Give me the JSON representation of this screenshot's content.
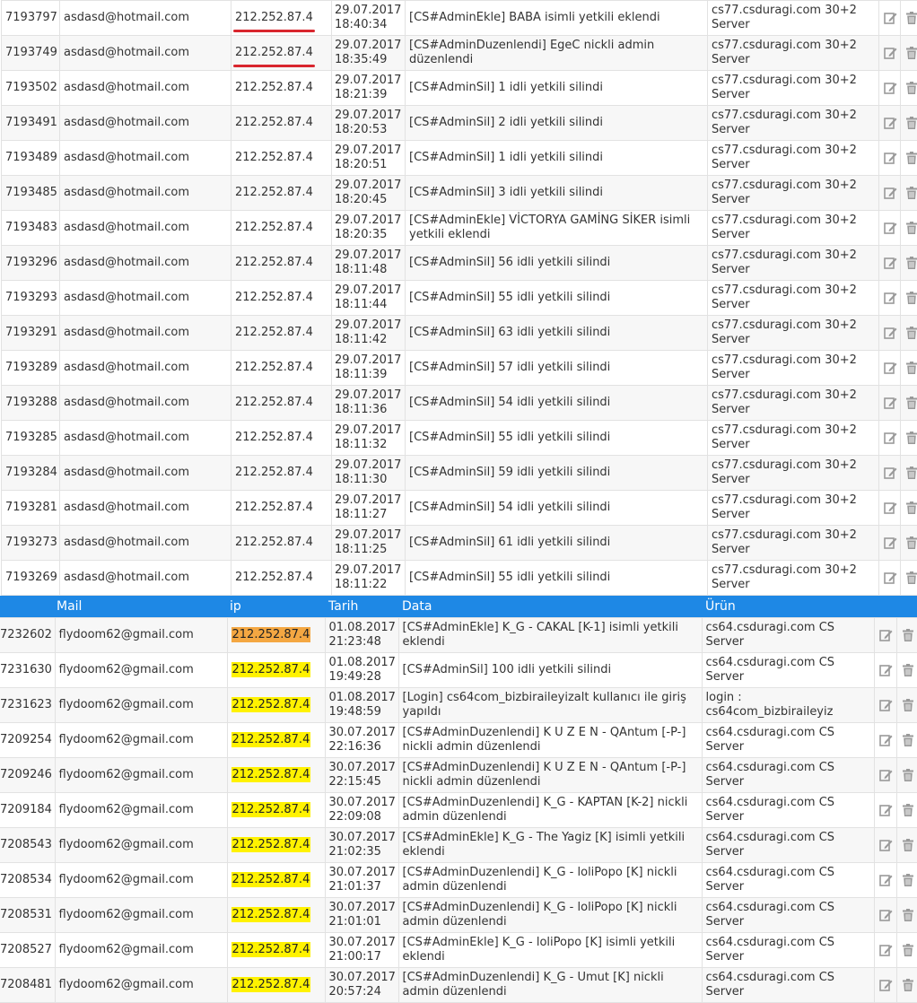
{
  "colors": {
    "header_bg": "#1e88e5",
    "ip_highlight_yellow": "#fff200",
    "ip_highlight_orange": "#f4a742",
    "underline_red": "#d9262e"
  },
  "icons": {
    "edit": "edit-icon",
    "delete": "trash-icon"
  },
  "table1": {
    "rows": [
      {
        "id": "7193797",
        "mail": "asdasd@hotmail.com",
        "ip": "212.252.87.4",
        "date": "29.07.2017",
        "time": "18:40:34",
        "data": "[CS#AdminEkle] BABA isimli yetkili eklendi",
        "product": "cs77.csduragi.com 30+2 Server",
        "underlined": true
      },
      {
        "id": "7193749",
        "mail": "asdasd@hotmail.com",
        "ip": "212.252.87.4",
        "date": "29.07.2017",
        "time": "18:35:49",
        "data": "[CS#AdminDuzenlendi] EgeC nickli admin düzenlendi",
        "product": "cs77.csduragi.com 30+2 Server",
        "underlined": true
      },
      {
        "id": "7193502",
        "mail": "asdasd@hotmail.com",
        "ip": "212.252.87.4",
        "date": "29.07.2017",
        "time": "18:21:39",
        "data": "[CS#AdminSil] 1 idli yetkili silindi",
        "product": "cs77.csduragi.com 30+2 Server"
      },
      {
        "id": "7193491",
        "mail": "asdasd@hotmail.com",
        "ip": "212.252.87.4",
        "date": "29.07.2017",
        "time": "18:20:53",
        "data": "[CS#AdminSil] 2 idli yetkili silindi",
        "product": "cs77.csduragi.com 30+2 Server"
      },
      {
        "id": "7193489",
        "mail": "asdasd@hotmail.com",
        "ip": "212.252.87.4",
        "date": "29.07.2017",
        "time": "18:20:51",
        "data": "[CS#AdminSil] 1 idli yetkili silindi",
        "product": "cs77.csduragi.com 30+2 Server"
      },
      {
        "id": "7193485",
        "mail": "asdasd@hotmail.com",
        "ip": "212.252.87.4",
        "date": "29.07.2017",
        "time": "18:20:45",
        "data": "[CS#AdminSil] 3 idli yetkili silindi",
        "product": "cs77.csduragi.com 30+2 Server"
      },
      {
        "id": "7193483",
        "mail": "asdasd@hotmail.com",
        "ip": "212.252.87.4",
        "date": "29.07.2017",
        "time": "18:20:35",
        "data": "[CS#AdminEkle] VİCTORYA GAMİNG SİKER isimli yetkili eklendi",
        "product": "cs77.csduragi.com 30+2 Server"
      },
      {
        "id": "7193296",
        "mail": "asdasd@hotmail.com",
        "ip": "212.252.87.4",
        "date": "29.07.2017",
        "time": "18:11:48",
        "data": "[CS#AdminSil] 56 idli yetkili silindi",
        "product": "cs77.csduragi.com 30+2 Server"
      },
      {
        "id": "7193293",
        "mail": "asdasd@hotmail.com",
        "ip": "212.252.87.4",
        "date": "29.07.2017",
        "time": "18:11:44",
        "data": "[CS#AdminSil] 55 idli yetkili silindi",
        "product": "cs77.csduragi.com 30+2 Server"
      },
      {
        "id": "7193291",
        "mail": "asdasd@hotmail.com",
        "ip": "212.252.87.4",
        "date": "29.07.2017",
        "time": "18:11:42",
        "data": "[CS#AdminSil] 63 idli yetkili silindi",
        "product": "cs77.csduragi.com 30+2 Server"
      },
      {
        "id": "7193289",
        "mail": "asdasd@hotmail.com",
        "ip": "212.252.87.4",
        "date": "29.07.2017",
        "time": "18:11:39",
        "data": "[CS#AdminSil] 57 idli yetkili silindi",
        "product": "cs77.csduragi.com 30+2 Server"
      },
      {
        "id": "7193288",
        "mail": "asdasd@hotmail.com",
        "ip": "212.252.87.4",
        "date": "29.07.2017",
        "time": "18:11:36",
        "data": "[CS#AdminSil] 54 idli yetkili silindi",
        "product": "cs77.csduragi.com 30+2 Server"
      },
      {
        "id": "7193285",
        "mail": "asdasd@hotmail.com",
        "ip": "212.252.87.4",
        "date": "29.07.2017",
        "time": "18:11:32",
        "data": "[CS#AdminSil] 55 idli yetkili silindi",
        "product": "cs77.csduragi.com 30+2 Server"
      },
      {
        "id": "7193284",
        "mail": "asdasd@hotmail.com",
        "ip": "212.252.87.4",
        "date": "29.07.2017",
        "time": "18:11:30",
        "data": "[CS#AdminSil] 59 idli yetkili silindi",
        "product": "cs77.csduragi.com 30+2 Server"
      },
      {
        "id": "7193281",
        "mail": "asdasd@hotmail.com",
        "ip": "212.252.87.4",
        "date": "29.07.2017",
        "time": "18:11:27",
        "data": "[CS#AdminSil] 54 idli yetkili silindi",
        "product": "cs77.csduragi.com 30+2 Server"
      },
      {
        "id": "7193273",
        "mail": "asdasd@hotmail.com",
        "ip": "212.252.87.4",
        "date": "29.07.2017",
        "time": "18:11:25",
        "data": "[CS#AdminSil] 61 idli yetkili silindi",
        "product": "cs77.csduragi.com 30+2 Server"
      },
      {
        "id": "7193269",
        "mail": "asdasd@hotmail.com",
        "ip": "212.252.87.4",
        "date": "29.07.2017",
        "time": "18:11:22",
        "data": "[CS#AdminSil] 55 idli yetkili silindi",
        "product": "cs77.csduragi.com 30+2 Server"
      }
    ]
  },
  "table2": {
    "headers": {
      "mail": "Mail",
      "ip": "ip",
      "date": "Tarih",
      "data": "Data",
      "product": "Ürün"
    },
    "rows": [
      {
        "id": "7232602",
        "mail": "flydoom62@gmail.com",
        "ip": "212.252.87.4",
        "highlight": "orange",
        "date": "01.08.2017",
        "time": "21:23:48",
        "data": "[CS#AdminEkle] K_G - CAKAL [K-1] isimli yetkili eklendi",
        "product": "cs64.csduragi.com CS Server"
      },
      {
        "id": "7231630",
        "mail": "flydoom62@gmail.com",
        "ip": "212.252.87.4",
        "highlight": "yellow",
        "date": "01.08.2017",
        "time": "19:49:28",
        "data": "[CS#AdminSil] 100 idli yetkili silindi",
        "product": "cs64.csduragi.com CS Server"
      },
      {
        "id": "7231623",
        "mail": "flydoom62@gmail.com",
        "ip": "212.252.87.4",
        "highlight": "yellow",
        "date": "01.08.2017",
        "time": "19:48:59",
        "data": "[Login] cs64com_bizbiraileyizalt kullanıcı ile giriş yapıldı",
        "product": "login : cs64com_bizbiraileyiz"
      },
      {
        "id": "7209254",
        "mail": "flydoom62@gmail.com",
        "ip": "212.252.87.4",
        "highlight": "yellow",
        "date": "30.07.2017",
        "time": "22:16:36",
        "data": "[CS#AdminDuzenlendi] K U Z E N - QAntum [-P-] nickli admin düzenlendi",
        "product": "cs64.csduragi.com CS Server"
      },
      {
        "id": "7209246",
        "mail": "flydoom62@gmail.com",
        "ip": "212.252.87.4",
        "highlight": "yellow",
        "date": "30.07.2017",
        "time": "22:15:45",
        "data": "[CS#AdminDuzenlendi] K U Z E N - QAntum [-P-] nickli admin düzenlendi",
        "product": "cs64.csduragi.com CS Server"
      },
      {
        "id": "7209184",
        "mail": "flydoom62@gmail.com",
        "ip": "212.252.87.4",
        "highlight": "yellow",
        "date": "30.07.2017",
        "time": "22:09:08",
        "data": "[CS#AdminDuzenlendi] K_G - KAPTAN [K-2] nickli admin düzenlendi",
        "product": "cs64.csduragi.com CS Server"
      },
      {
        "id": "7208543",
        "mail": "flydoom62@gmail.com",
        "ip": "212.252.87.4",
        "highlight": "yellow",
        "date": "30.07.2017",
        "time": "21:02:35",
        "data": "[CS#AdminEkle] K_G - The Yagiz [K] isimli yetkili eklendi",
        "product": "cs64.csduragi.com CS Server"
      },
      {
        "id": "7208534",
        "mail": "flydoom62@gmail.com",
        "ip": "212.252.87.4",
        "highlight": "yellow",
        "date": "30.07.2017",
        "time": "21:01:37",
        "data": "[CS#AdminDuzenlendi] K_G - loliPopo [K] nickli admin düzenlendi",
        "product": "cs64.csduragi.com CS Server"
      },
      {
        "id": "7208531",
        "mail": "flydoom62@gmail.com",
        "ip": "212.252.87.4",
        "highlight": "yellow",
        "date": "30.07.2017",
        "time": "21:01:01",
        "data": "[CS#AdminDuzenlendi] K_G - loliPopo [K] nickli admin düzenlendi",
        "product": "cs64.csduragi.com CS Server"
      },
      {
        "id": "7208527",
        "mail": "flydoom62@gmail.com",
        "ip": "212.252.87.4",
        "highlight": "yellow",
        "date": "30.07.2017",
        "time": "21:00:17",
        "data": "[CS#AdminEkle] K_G - loliPopo [K] isimli yetkili eklendi",
        "product": "cs64.csduragi.com CS Server"
      },
      {
        "id": "7208481",
        "mail": "flydoom62@gmail.com",
        "ip": "212.252.87.4",
        "highlight": "yellow",
        "date": "30.07.2017",
        "time": "20:57:24",
        "data": "[CS#AdminDuzenlendi] K_G - Umut [K] nickli admin düzenlendi",
        "product": "cs64.csduragi.com CS Server"
      }
    ]
  }
}
